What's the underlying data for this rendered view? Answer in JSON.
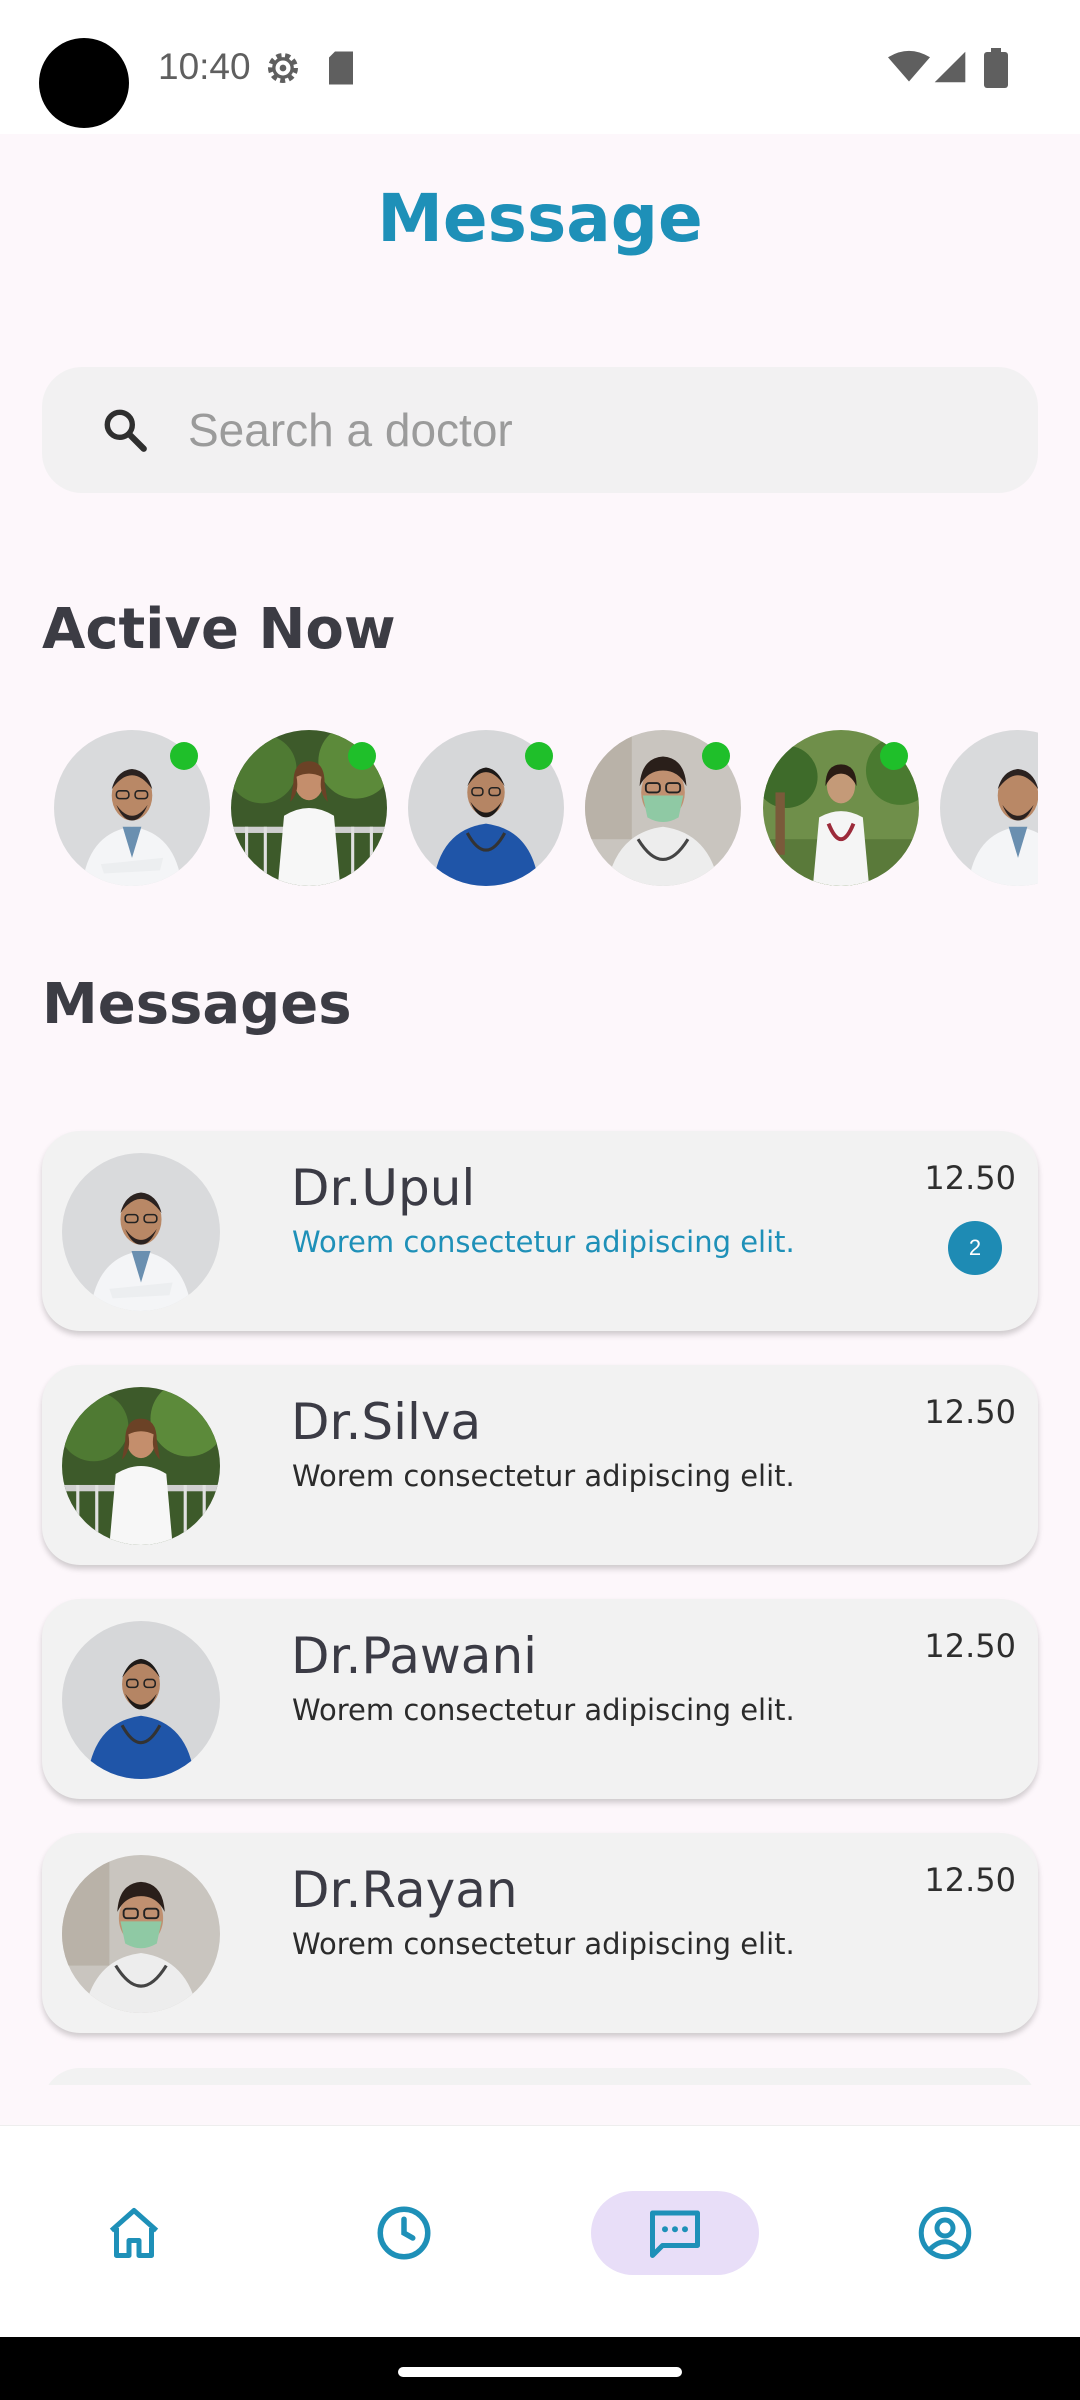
{
  "status_bar": {
    "time": "10:40"
  },
  "header": {
    "title": "Message"
  },
  "search": {
    "placeholder": "Search a doctor",
    "value": ""
  },
  "active_now": {
    "title": "Active Now",
    "doctors": [
      {
        "avatar": "doctor-white-coat",
        "online": true
      },
      {
        "avatar": "doctor-woman-outdoor",
        "online": true
      },
      {
        "avatar": "doctor-blue-shirt",
        "online": true
      },
      {
        "avatar": "doctor-mask",
        "online": true
      },
      {
        "avatar": "doctor-woman-park",
        "online": true
      },
      {
        "avatar": "doctor-white-coat",
        "online": false
      }
    ]
  },
  "messages": {
    "title": "Messages",
    "items": [
      {
        "name": "Dr.Upul",
        "preview": "Worem consectetur adipiscing elit.",
        "time": "12.50",
        "unread": "2"
      },
      {
        "name": "Dr.Silva",
        "preview": "Worem consectetur adipiscing elit.",
        "time": "12.50"
      },
      {
        "name": "Dr.Pawani",
        "preview": "Worem consectetur adipiscing elit.",
        "time": "12.50"
      },
      {
        "name": "Dr.Rayan",
        "preview": "Worem consectetur adipiscing elit.",
        "time": "12.50"
      }
    ]
  },
  "bottom_nav": {
    "items": [
      {
        "icon": "home-icon",
        "active": false
      },
      {
        "icon": "clock-icon",
        "active": false
      },
      {
        "icon": "chat-icon",
        "active": true
      },
      {
        "icon": "profile-icon",
        "active": false
      }
    ]
  },
  "colors": {
    "accent": "#1e90b8",
    "online": "#1fbf2a",
    "nav_active_bg": "#e8def8"
  }
}
